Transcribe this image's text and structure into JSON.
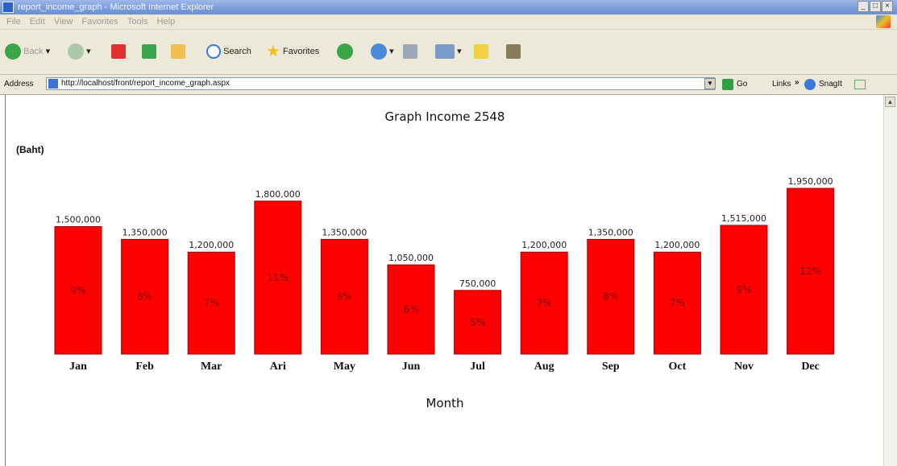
{
  "window": {
    "title": "report_income_graph - Microsoft Internet Explorer",
    "controls": [
      "_",
      "□",
      "×"
    ]
  },
  "menu": [
    "File",
    "Edit",
    "View",
    "Favorites",
    "Tools",
    "Help"
  ],
  "toolbar": {
    "back_label": "Back",
    "search_label": "Search",
    "favorites_label": "Favorites"
  },
  "addressbar": {
    "label": "Address",
    "url": "http://localhost/front/report_income_graph.aspx",
    "go_label": "Go",
    "links_label": "Links",
    "chevron": "»",
    "snagit_label": "SnagIt"
  },
  "chart_data": {
    "type": "bar",
    "title": "Graph Income 2548",
    "ylabel": "(Baht)",
    "xlabel": "Month",
    "categories": [
      "Jan",
      "Feb",
      "Mar",
      "Ari",
      "May",
      "Jun",
      "Jul",
      "Aug",
      "Sep",
      "Oct",
      "Nov",
      "Dec"
    ],
    "values": [
      1500000,
      1350000,
      1200000,
      1800000,
      1350000,
      1050000,
      750000,
      1200000,
      1350000,
      1200000,
      1515000,
      1950000
    ],
    "value_labels": [
      "1,500,000",
      "1,350,000",
      "1,200,000",
      "1,800,000",
      "1,350,000",
      "1,050,000",
      "750,000",
      "1,200,000",
      "1,350,000",
      "1,200,000",
      "1,515,000",
      "1,950,000"
    ],
    "percent_labels": [
      "9%",
      "8%",
      "7%",
      "11%",
      "8%",
      "6%",
      "5%",
      "7%",
      "8%",
      "7%",
      "9%",
      "12%"
    ],
    "ylim": [
      0,
      1950000
    ],
    "bar_color": "#ff0000",
    "bar_edge_color": "#aa0000",
    "grid": false,
    "legend": "none"
  }
}
